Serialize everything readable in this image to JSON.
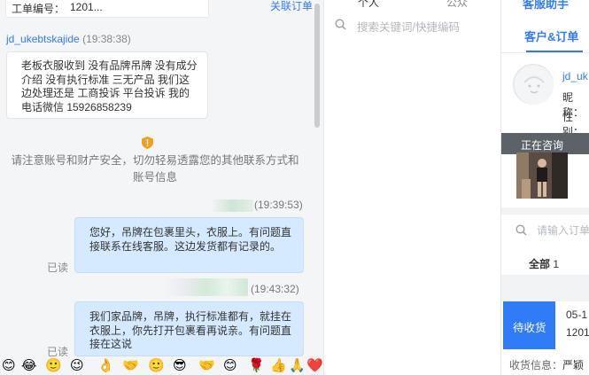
{
  "chat": {
    "top_label": "工单编号：",
    "top_value": "1201...",
    "top_link": "关联订单",
    "sender_name": "jd_ukebtskajide",
    "sender_time": "(19:38:38)",
    "customer_message": "老板衣服收到 没有品牌吊牌 没有成分介绍 没有执行标准 三无产品 我们这边处理还是 工商投诉 平台投诉 我的电话微信 15926858239",
    "notice": "请注意账号和财产安全，切勿轻易透露您的其他联系方式和账号信息",
    "reply1_time": "(19:39:53)",
    "reply1": "您好，吊牌在包裹里头，衣服上。有问题直接联系在线客服。这边发货都有记录的。",
    "reply1_status": "已读",
    "reply2_time": "(19:43:32)",
    "reply2": "我们家品牌，吊牌，执行标准都有，就挂在衣服上，你先打开包裹看再说亲。有问题直接在这说",
    "reply2_status": "已读"
  },
  "emoji_bar": [
    "😊",
    "😂",
    "🙂",
    "😉",
    "👌",
    "🤝",
    "🙂",
    "😎",
    "🤝",
    "😊",
    "🌹",
    "👍",
    "🙏",
    "❤️"
  ],
  "search": {
    "tab_a": "个人",
    "tab_b": "公众",
    "placeholder": "搜索关键词/快捷编码"
  },
  "customer_panel": {
    "header": "客服助手",
    "tab": "客户&订单",
    "name": "jd_uk",
    "nick_label": "昵称：",
    "sex_label": "性别：",
    "consult_label": "正在咨询",
    "order_search_placeholder": "请输入订单",
    "all_tab_label": "全部",
    "all_tab_count": "1",
    "pending_label": "待收货",
    "order_date": "05-1",
    "order_no": "1201",
    "recv_label": "收货信息：",
    "recv_value": "严颖"
  },
  "colors": {
    "accent": "#2f7cf6",
    "out_bubble": "#d6eaff",
    "chat_bg": "#f4f5f7",
    "notice_icon": "#f0a020"
  }
}
